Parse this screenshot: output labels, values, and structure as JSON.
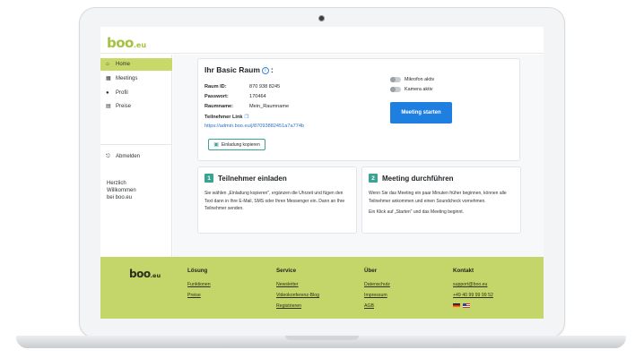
{
  "brand": {
    "logo_main": "boo",
    "logo_suffix": ".eu"
  },
  "sidebar": {
    "items": [
      {
        "label": "Home",
        "icon": "home-icon",
        "active": true
      },
      {
        "label": "Meetings",
        "icon": "calendar-icon",
        "active": false
      },
      {
        "label": "Profil",
        "icon": "user-icon",
        "active": false
      },
      {
        "label": "Preise",
        "icon": "document-icon",
        "active": false
      }
    ],
    "logout_label": "Abmelden",
    "welcome_line1": "Herzlich",
    "welcome_line2": "Willkommen",
    "welcome_line3": "bei boo.eu"
  },
  "room": {
    "title": "Ihr Basic Raum",
    "title_suffix": ":",
    "id_label": "Raum ID:",
    "id_value": "870 938 8245",
    "password_label": "Passwort:",
    "password_value": "170464",
    "name_label": "Raumname:",
    "name_value": "Mein_Raumname",
    "link_label": "Teilnehmer Link",
    "link_url": "https://admin.boo.eu/j/87093882451a7a774b",
    "invite_button": "Einladung kopieren",
    "mic_label": "Mikrofon aktiv",
    "camera_label": "Kamera aktiv",
    "mic_enabled": false,
    "camera_enabled": false,
    "start_button": "Meeting starten"
  },
  "steps": [
    {
      "number": "1",
      "title": "Teilnehmer einladen",
      "text": "Sie wählen „Einladung kopieren\", ergänzen die Uhrzeit und fügen den Text dann in Ihre E-Mail, SMS oder Ihren Messenger ein. Dann an Ihre Teilnehmer senden."
    },
    {
      "number": "2",
      "title": "Meeting durchführen",
      "text": "Wenn Sie das Meeting ein paar Minuten früher beginnen, können alle Teilnehmer ankommen und einen Soundcheck vornehmen.",
      "text2": "Ein Klick auf „Starten\" und das Meeting beginnt."
    }
  ],
  "footer": {
    "logo_main": "boo",
    "logo_suffix": ".eu",
    "columns": [
      {
        "heading": "Lösung",
        "links": [
          "Funktionen",
          "Preise"
        ]
      },
      {
        "heading": "Service",
        "links": [
          "Newsletter",
          "Videokonferenz-Blog",
          "Registrieren"
        ]
      },
      {
        "heading": "Über",
        "links": [
          "Datenschutz",
          "Impressum",
          "AGB"
        ]
      },
      {
        "heading": "Kontakt",
        "links": [
          "support@boo.eu",
          "+49 40 99 99 99 52"
        ]
      }
    ],
    "languages": [
      "de",
      "en"
    ]
  },
  "colors": {
    "brand_green": "#a4c23b",
    "sidebar_active": "#c8d96a",
    "footer_bg": "#c4d56a",
    "accent_teal": "#3aa391",
    "primary_blue": "#1f7fe0"
  }
}
